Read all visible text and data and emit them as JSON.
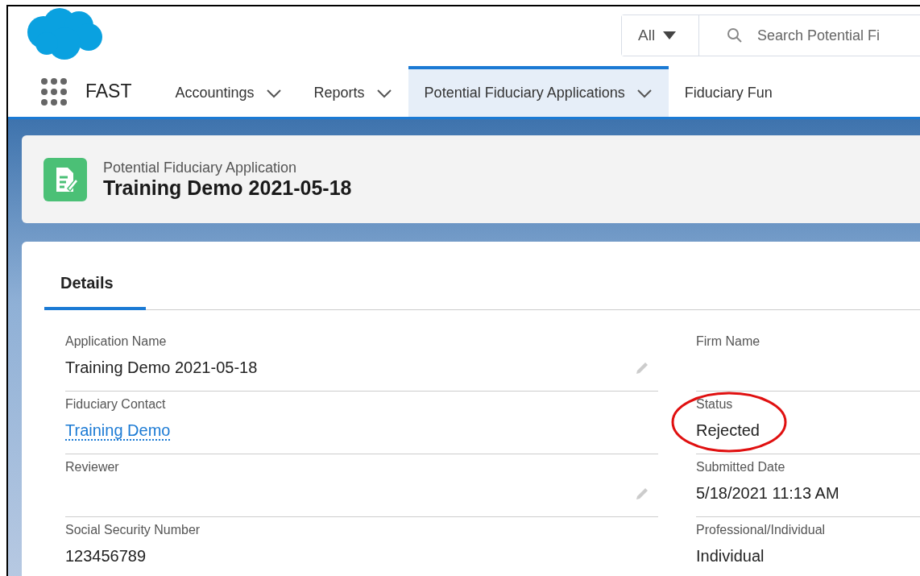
{
  "search": {
    "scope": "All",
    "placeholder": "Search Potential Fi"
  },
  "nav": {
    "app_name": "FAST",
    "items": [
      {
        "label": "Accountings",
        "selected": false,
        "dropdown": true
      },
      {
        "label": "Reports",
        "selected": false,
        "dropdown": true
      },
      {
        "label": "Potential Fiduciary Applications",
        "selected": true,
        "dropdown": true
      },
      {
        "label": "Fiduciary Fun",
        "selected": false,
        "dropdown": false
      }
    ]
  },
  "record": {
    "object_type": "Potential Fiduciary Application",
    "title": "Training Demo 2021-05-18"
  },
  "tabs": [
    {
      "label": "Details",
      "selected": true
    }
  ],
  "fields": [
    {
      "left": {
        "label": "Application Name",
        "value": "Training Demo 2021-05-18",
        "kind": "text",
        "editable": true,
        "circled": false
      },
      "right": {
        "label": "Firm Name",
        "editable": false,
        "circled": false
      }
    },
    {
      "left": {
        "label": "Fiduciary Contact",
        "value": "Training Demo",
        "kind": "link",
        "editable": false,
        "circled": false
      },
      "right": {
        "label": "Status",
        "value": "Rejected",
        "kind": "text",
        "editable": false,
        "circled": true
      }
    },
    {
      "left": {
        "label": "Reviewer",
        "editable": true,
        "circled": false
      },
      "right": {
        "label": "Submitted Date",
        "value": "5/18/2021 11:13 AM",
        "kind": "text",
        "editable": false,
        "circled": false
      }
    },
    {
      "left": {
        "label": "Social Security Number",
        "value": "123456789",
        "kind": "text",
        "editable": false,
        "circled": false
      },
      "right": {
        "label": "Professional/Individual",
        "value": "Individual",
        "kind": "text",
        "editable": false,
        "circled": false
      }
    }
  ]
}
